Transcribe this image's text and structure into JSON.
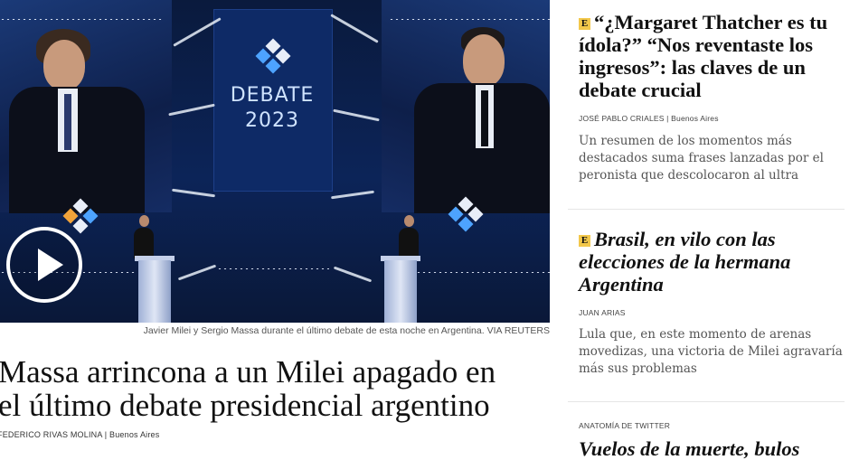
{
  "hero": {
    "debate_logo_line1": "DEBATE",
    "debate_logo_line2": "2023",
    "caption": "Javier Milei y Sergio Massa durante el último debate de esta noche en Argentina. VIA REUTERS"
  },
  "main_article": {
    "headline_line1": "Massa arrincona a un Milei apagado en",
    "headline_line2": "el último debate presidencial argentino",
    "author": "FEDERICO RIVAS MOLINA",
    "location": "Buenos Aires"
  },
  "sidebar": {
    "articles": [
      {
        "badge": "E",
        "title": "“¿Margaret Thatcher es tu ídola?” “Nos reventaste los ingresos”: las claves de un debate crucial",
        "author": "JOSÉ PABLO CRIALES",
        "location": "Buenos Aires",
        "description": "Un resumen de los momentos más destacados suma frases lanzadas por el peronista que descolocaron al ultra"
      },
      {
        "badge": "E",
        "title": "Brasil, en vilo con las elecciones de la hermana Argentina",
        "author": "JUAN ARIAS",
        "description": "Lula que, en este momento de arenas movedizas, una victoria de Milei agravaría más sus problemas"
      },
      {
        "section": "ANATOMÍA DE TWITTER",
        "title": "Vuelos de la muerte, bulos"
      }
    ]
  },
  "colors": {
    "badge": "#f3c84b",
    "hero_bg": "#0c2458",
    "text": "#111111",
    "muted": "#555555"
  },
  "icons": {
    "play": "play-icon",
    "badge": "premium-e-badge-icon"
  }
}
